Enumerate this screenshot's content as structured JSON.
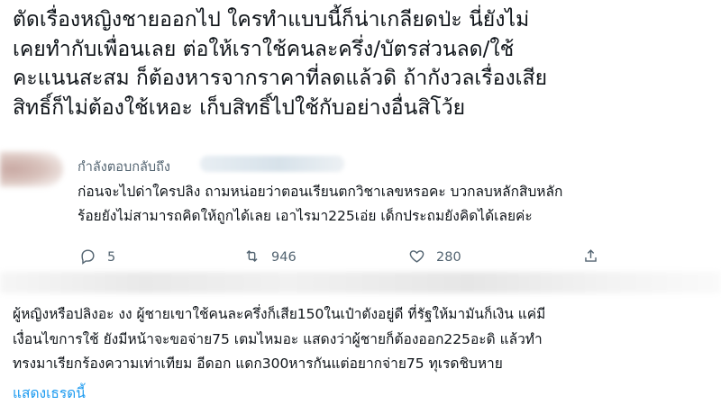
{
  "main_tweet": {
    "lines": [
      "ตัดเรื่องหญิงชายออกไป ใครทำแบบนี้ก็น่าเกลียดป่ะ นี่ยังไม่",
      "เคยทำกับเพื่อนเลย ต่อให้เราใช้คนละครึ่ง/บัตรส่วนลด/ใช้",
      "คะแนนสะสม ก็ต้องหารจากราคาที่ลดแล้วดิ ถ้ากังวลเรื่องเสีย",
      "สิทธิ์ก็ไม่ต้องใช้เหอะ เก็บสิทธิ์ไปใช้กับอย่างอื่นสิโว้ย"
    ]
  },
  "reply": {
    "replying_to_label": "กำลังตอบกลับถึง",
    "lines": [
      "ก่อนจะไปด่าใครปลิง ถามหน่อยว่าตอนเรียนตกวิชาเลขหรอคะ บวกลบหลักสิบหลัก",
      "ร้อยยังไม่สามารถคิดให้ถูกได้เลย เอาไรมา225เอ่ย เด็กประถมยังคิดได้เลยค่ะ"
    ],
    "actions": {
      "reply_count": "5",
      "retweet_count": "946",
      "like_count": "280"
    }
  },
  "second_tweet": {
    "lines": [
      "ผู้หญิงหรือปลิงอะ งง ผู้ชายเขาใช้คนละครึ่งก็เสีย150ในเป๋าตังอยู่ดี ที่รัฐให้มามันก็เงิน แค่มี",
      "เงื่อนไขการใช้ ยังมีหน้าจะขอจ่าย75 เตมไหมอะ แสดงว่าผู้ชายก็ต้องออก225อะดิ แล้วทำ",
      "ทรงมาเรียกร้องความเท่าเทียม อีดอก แดก300หารกันแต่อยากจ่าย75 ทุเรดชิบหาย"
    ],
    "show_thread_label": "แสดงเธรดนี้"
  },
  "colors": {
    "text": "#0f1419",
    "secondary": "#536471",
    "link": "#1d9bf0"
  }
}
